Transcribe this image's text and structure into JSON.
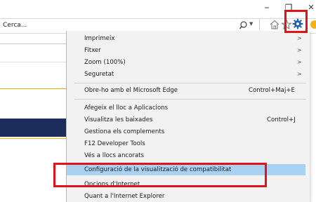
{
  "window": {
    "minimize_glyph": "–",
    "restore_glyph": "❐",
    "close_glyph": "✕"
  },
  "search": {
    "text": "Cerca..."
  },
  "icons": {
    "search": "search-icon",
    "dropdown": "chevron-down-icon",
    "home": "home-icon",
    "favorites": "star-icon",
    "tools": "gear-icon",
    "feedback": "smiley-icon"
  },
  "colors": {
    "gear_blue": "#1e63b5",
    "highlight": "#a9d2f2",
    "annotation_red": "#e0131a",
    "page_banner": "#1c2c5c"
  },
  "menu": {
    "items": [
      {
        "label": "Imprimeix",
        "submenu": true
      },
      {
        "label": "Fitxer",
        "submenu": true
      },
      {
        "label": "Zoom (100%)",
        "submenu": true
      },
      {
        "label": "Seguretat",
        "submenu": true
      },
      {
        "label": "Obre-ho amb el Microsoft Edge",
        "shortcut": "Control+Maj+E"
      },
      {
        "label": "Afegeix el lloc a Aplicacions"
      },
      {
        "label": "Visualitza les baixades",
        "shortcut": "Control+J"
      },
      {
        "label": "Gestiona els complements"
      },
      {
        "label": "F12 Developer Tools"
      },
      {
        "label": "Vés a llocs ancorats"
      },
      {
        "label": "Configuració de la visualització de compatibilitat",
        "highlighted": true
      },
      {
        "label": "Opcions d'Internet"
      },
      {
        "label": "Quant a l'Internet Explorer"
      }
    ],
    "submenu_glyph": ">"
  }
}
